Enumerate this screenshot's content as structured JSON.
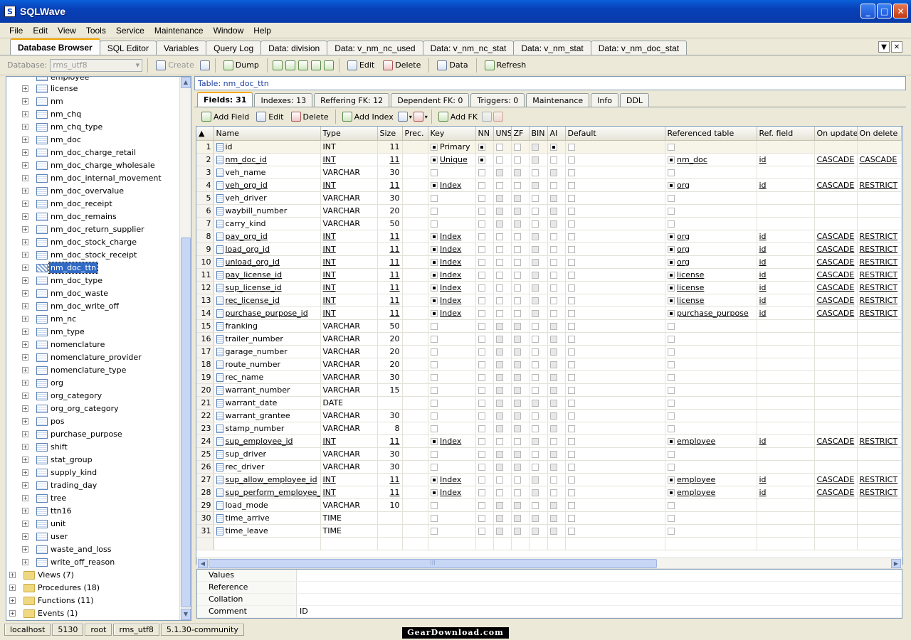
{
  "window": {
    "title": "SQLWave"
  },
  "menu": [
    "File",
    "Edit",
    "View",
    "Tools",
    "Service",
    "Maintenance",
    "Window",
    "Help"
  ],
  "main_tabs": [
    "Database Browser",
    "SQL Editor",
    "Variables",
    "Query Log",
    "Data: division",
    "Data: v_nm_nc_used",
    "Data: v_nm_nc_stat",
    "Data: v_nm_stat",
    "Data: v_nm_doc_stat"
  ],
  "toolbar": {
    "database_label": "Database:",
    "database_value": "rms_utf8",
    "create": "Create",
    "dump": "Dump",
    "edit": "Edit",
    "delete": "Delete",
    "data": "Data",
    "refresh": "Refresh"
  },
  "tree": {
    "partial_top": "employee",
    "tables": [
      "license",
      "nm",
      "nm_chq",
      "nm_chq_type",
      "nm_doc",
      "nm_doc_charge_retail",
      "nm_doc_charge_wholesale",
      "nm_doc_internal_movement",
      "nm_doc_overvalue",
      "nm_doc_receipt",
      "nm_doc_remains",
      "nm_doc_return_supplier",
      "nm_doc_stock_charge",
      "nm_doc_stock_receipt",
      "nm_doc_ttn",
      "nm_doc_type",
      "nm_doc_waste",
      "nm_doc_write_off",
      "nm_nc",
      "nm_type",
      "nomenclature",
      "nomenclature_provider",
      "nomenclature_type",
      "org",
      "org_category",
      "org_org_category",
      "pos",
      "purchase_purpose",
      "shift",
      "stat_group",
      "supply_kind",
      "trading_day",
      "tree",
      "ttn16",
      "unit",
      "user",
      "waste_and_loss",
      "write_off_reason"
    ],
    "selected": "nm_doc_ttn",
    "groups": [
      "Views (7)",
      "Procedures (18)",
      "Functions (11)",
      "Events (1)"
    ]
  },
  "table_label": "Table: nm_doc_ttn",
  "sub_tabs": [
    "Fields: 31",
    "Indexes: 13",
    "Reffering FK: 12",
    "Dependent FK: 0",
    "Triggers: 0",
    "Maintenance",
    "Info",
    "DDL"
  ],
  "sub_toolbar": {
    "add_field": "Add Field",
    "edit": "Edit",
    "delete": "Delete",
    "add_index": "Add Index",
    "add_fk": "Add FK"
  },
  "columns": [
    "Name",
    "Type",
    "Size",
    "Prec.",
    "Key",
    "NN",
    "UNS",
    "ZF",
    "BIN",
    "AI",
    "Default",
    "Referenced table",
    "Ref. field",
    "On update",
    "On delete"
  ],
  "rows": [
    {
      "n": "1",
      "name": "id",
      "type": "INT",
      "size": "11",
      "key": "Primary",
      "nn": true,
      "ai": true,
      "ref": "",
      "rf": "",
      "upd": "",
      "del": ""
    },
    {
      "n": "2",
      "name": "nm_doc_id",
      "type": "INT",
      "size": "11",
      "key": "Unique",
      "nn": true,
      "ai": false,
      "ref": "nm_doc",
      "rf": "id",
      "upd": "CASCADE",
      "del": "CASCADE"
    },
    {
      "n": "3",
      "name": "veh_name",
      "type": "VARCHAR",
      "size": "30",
      "key": "",
      "nn": false,
      "ai": false,
      "ref": "",
      "rf": "",
      "upd": "",
      "del": ""
    },
    {
      "n": "4",
      "name": "veh_org_id",
      "type": "INT",
      "size": "11",
      "key": "Index",
      "nn": false,
      "ai": false,
      "ref": "org",
      "rf": "id",
      "upd": "CASCADE",
      "del": "RESTRICT"
    },
    {
      "n": "5",
      "name": "veh_driver",
      "type": "VARCHAR",
      "size": "30",
      "key": "",
      "nn": false,
      "ai": false,
      "ref": "",
      "rf": "",
      "upd": "",
      "del": ""
    },
    {
      "n": "6",
      "name": "waybill_number",
      "type": "VARCHAR",
      "size": "20",
      "key": "",
      "nn": false,
      "ai": false,
      "ref": "",
      "rf": "",
      "upd": "",
      "del": ""
    },
    {
      "n": "7",
      "name": "carry_kind",
      "type": "VARCHAR",
      "size": "50",
      "key": "",
      "nn": false,
      "ai": false,
      "ref": "",
      "rf": "",
      "upd": "",
      "del": ""
    },
    {
      "n": "8",
      "name": "pay_org_id",
      "type": "INT",
      "size": "11",
      "key": "Index",
      "nn": false,
      "ai": false,
      "ref": "org",
      "rf": "id",
      "upd": "CASCADE",
      "del": "RESTRICT"
    },
    {
      "n": "9",
      "name": "load_org_id",
      "type": "INT",
      "size": "11",
      "key": "Index",
      "nn": false,
      "ai": false,
      "ref": "org",
      "rf": "id",
      "upd": "CASCADE",
      "del": "RESTRICT"
    },
    {
      "n": "10",
      "name": "unload_org_id",
      "type": "INT",
      "size": "11",
      "key": "Index",
      "nn": false,
      "ai": false,
      "ref": "org",
      "rf": "id",
      "upd": "CASCADE",
      "del": "RESTRICT"
    },
    {
      "n": "11",
      "name": "pay_license_id",
      "type": "INT",
      "size": "11",
      "key": "Index",
      "nn": false,
      "ai": false,
      "ref": "license",
      "rf": "id",
      "upd": "CASCADE",
      "del": "RESTRICT"
    },
    {
      "n": "12",
      "name": "sup_license_id",
      "type": "INT",
      "size": "11",
      "key": "Index",
      "nn": false,
      "ai": false,
      "ref": "license",
      "rf": "id",
      "upd": "CASCADE",
      "del": "RESTRICT"
    },
    {
      "n": "13",
      "name": "rec_license_id",
      "type": "INT",
      "size": "11",
      "key": "Index",
      "nn": false,
      "ai": false,
      "ref": "license",
      "rf": "id",
      "upd": "CASCADE",
      "del": "RESTRICT"
    },
    {
      "n": "14",
      "name": "purchase_purpose_id",
      "type": "INT",
      "size": "11",
      "key": "Index",
      "nn": false,
      "ai": false,
      "ref": "purchase_purpose",
      "rf": "id",
      "upd": "CASCADE",
      "del": "RESTRICT"
    },
    {
      "n": "15",
      "name": "franking",
      "type": "VARCHAR",
      "size": "50",
      "key": "",
      "nn": false,
      "ai": false,
      "ref": "",
      "rf": "",
      "upd": "",
      "del": ""
    },
    {
      "n": "16",
      "name": "trailer_number",
      "type": "VARCHAR",
      "size": "20",
      "key": "",
      "nn": false,
      "ai": false,
      "ref": "",
      "rf": "",
      "upd": "",
      "del": ""
    },
    {
      "n": "17",
      "name": "garage_number",
      "type": "VARCHAR",
      "size": "20",
      "key": "",
      "nn": false,
      "ai": false,
      "ref": "",
      "rf": "",
      "upd": "",
      "del": ""
    },
    {
      "n": "18",
      "name": "route_number",
      "type": "VARCHAR",
      "size": "20",
      "key": "",
      "nn": false,
      "ai": false,
      "ref": "",
      "rf": "",
      "upd": "",
      "del": ""
    },
    {
      "n": "19",
      "name": "rec_name",
      "type": "VARCHAR",
      "size": "30",
      "key": "",
      "nn": false,
      "ai": false,
      "ref": "",
      "rf": "",
      "upd": "",
      "del": ""
    },
    {
      "n": "20",
      "name": "warrant_number",
      "type": "VARCHAR",
      "size": "15",
      "key": "",
      "nn": false,
      "ai": false,
      "ref": "",
      "rf": "",
      "upd": "",
      "del": ""
    },
    {
      "n": "21",
      "name": "warrant_date",
      "type": "DATE",
      "size": "",
      "key": "",
      "nn": false,
      "ai": false,
      "ref": "",
      "rf": "",
      "upd": "",
      "del": ""
    },
    {
      "n": "22",
      "name": "warrant_grantee",
      "type": "VARCHAR",
      "size": "30",
      "key": "",
      "nn": false,
      "ai": false,
      "ref": "",
      "rf": "",
      "upd": "",
      "del": ""
    },
    {
      "n": "23",
      "name": "stamp_number",
      "type": "VARCHAR",
      "size": "8",
      "key": "",
      "nn": false,
      "ai": false,
      "ref": "",
      "rf": "",
      "upd": "",
      "del": ""
    },
    {
      "n": "24",
      "name": "sup_employee_id",
      "type": "INT",
      "size": "11",
      "key": "Index",
      "nn": false,
      "ai": false,
      "ref": "employee",
      "rf": "id",
      "upd": "CASCADE",
      "del": "RESTRICT"
    },
    {
      "n": "25",
      "name": "sup_driver",
      "type": "VARCHAR",
      "size": "30",
      "key": "",
      "nn": false,
      "ai": false,
      "ref": "",
      "rf": "",
      "upd": "",
      "del": ""
    },
    {
      "n": "26",
      "name": "rec_driver",
      "type": "VARCHAR",
      "size": "30",
      "key": "",
      "nn": false,
      "ai": false,
      "ref": "",
      "rf": "",
      "upd": "",
      "del": ""
    },
    {
      "n": "27",
      "name": "sup_allow_employee_id",
      "type": "INT",
      "size": "11",
      "key": "Index",
      "nn": false,
      "ai": false,
      "ref": "employee",
      "rf": "id",
      "upd": "CASCADE",
      "del": "RESTRICT"
    },
    {
      "n": "28",
      "name": "sup_perform_employee_id",
      "type": "INT",
      "size": "11",
      "key": "Index",
      "nn": false,
      "ai": false,
      "ref": "employee",
      "rf": "id",
      "upd": "CASCADE",
      "del": "RESTRICT"
    },
    {
      "n": "29",
      "name": "load_mode",
      "type": "VARCHAR",
      "size": "10",
      "key": "",
      "nn": false,
      "ai": false,
      "ref": "",
      "rf": "",
      "upd": "",
      "del": ""
    },
    {
      "n": "30",
      "name": "time_arrive",
      "type": "TIME",
      "size": "",
      "key": "",
      "nn": false,
      "ai": false,
      "ref": "",
      "rf": "",
      "upd": "",
      "del": ""
    },
    {
      "n": "31",
      "name": "time_leave",
      "type": "TIME",
      "size": "",
      "key": "",
      "nn": false,
      "ai": false,
      "ref": "",
      "rf": "",
      "upd": "",
      "del": ""
    }
  ],
  "props": [
    {
      "k": "Values",
      "v": ""
    },
    {
      "k": "Reference",
      "v": ""
    },
    {
      "k": "Collation",
      "v": ""
    },
    {
      "k": "Comment",
      "v": "ID"
    }
  ],
  "status": [
    "localhost",
    "5130",
    "root",
    "rms_utf8",
    "5.1.30-community"
  ],
  "watermark": "GearDownload.com"
}
